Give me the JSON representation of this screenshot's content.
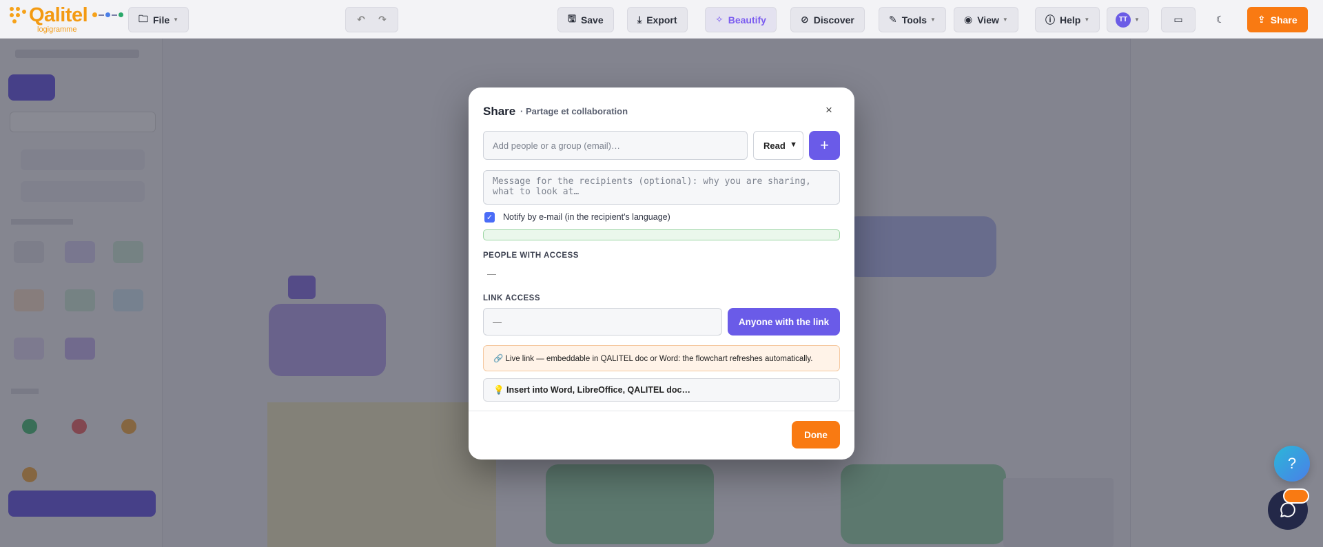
{
  "app": {
    "logo_name": "Qalitel",
    "logo_sub": "logigramme"
  },
  "toolbar": {
    "file_label": "File",
    "save_label": "Save",
    "export_label": "Export",
    "beautify_label": "Beautify",
    "discover_label": "Discover",
    "tools_label": "Tools",
    "view_label": "View",
    "help_label": "Help",
    "avatar_initials": "TT",
    "share_label": "Share"
  },
  "modal": {
    "title": "Share",
    "subtitle": "· Partage et collaboration",
    "close": "×",
    "recipient_placeholder": "Add people or a group (email)…",
    "permission_value": "Read",
    "add_symbol": "+",
    "message_placeholder": "Message for the recipients (optional): why you are sharing, what to look at…",
    "notify_label": "Notify by e-mail (in the recipient's language)",
    "notify_checked": true,
    "people_section": "PEOPLE WITH ACCESS",
    "people_empty": "—",
    "link_section": "LINK ACCESS",
    "link_value": "—",
    "anyone_label": "Anyone with the link",
    "live_link_text": "🔗 Live link — embeddable in QALITEL doc or Word: the flowchart refreshes automatically.",
    "insert_text": "💡 Insert into Word, LibreOffice, QALITEL doc…",
    "done_label": "Done"
  },
  "fab": {
    "help_symbol": "?"
  },
  "colors": {
    "accent": "#6a5be8",
    "brand_orange": "#f97a12",
    "logo_orange": "#f39a12"
  }
}
